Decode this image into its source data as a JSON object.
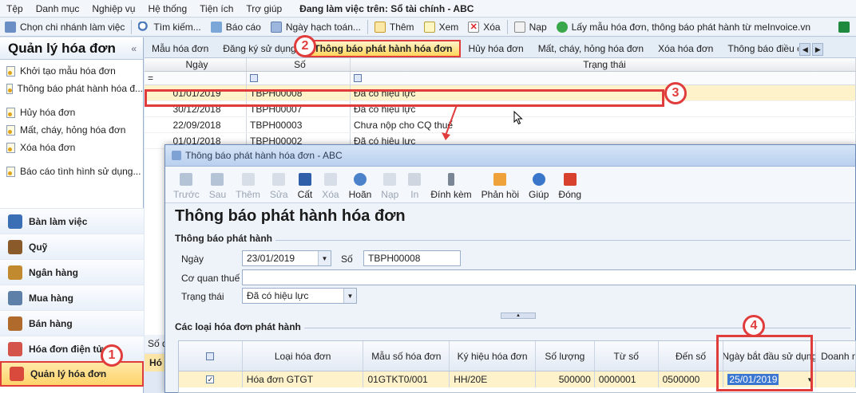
{
  "menu": {
    "items": [
      "Tệp",
      "Danh mục",
      "Nghiệp vụ",
      "Hệ thống",
      "Tiện ích",
      "Trợ giúp"
    ],
    "working_on": "Đang làm việc trên: Sổ tài chính - ABC"
  },
  "toolbar": {
    "branch": "Chọn chi nhánh làm việc",
    "search": "Tìm kiếm...",
    "report": "Báo cáo",
    "posting_date": "Ngày hạch toán...",
    "add": "Thêm",
    "view": "Xem",
    "delete": "Xóa",
    "load": "Nạp",
    "get_template": "Lấy mẫu hóa đơn, thông báo phát hành từ meInvoice.vn"
  },
  "sidebar": {
    "title": "Quản lý hóa đơn",
    "collapse": "«",
    "items": [
      "Khởi tạo mẫu hóa đơn",
      "Thông báo phát hành hóa đ...",
      "Hủy hóa đơn",
      "Mất, cháy, hỏng hóa đơn",
      "Xóa hóa đơn",
      "Báo cáo tình hình sử dụng..."
    ],
    "modules": [
      "Bàn làm việc",
      "Quỹ",
      "Ngân hàng",
      "Mua hàng",
      "Bán hàng",
      "Hóa đơn điện tử",
      "Quản lý hóa đơn"
    ]
  },
  "tabs": [
    "Mẫu hóa đơn",
    "Đăng ký sử dụng h",
    "Thông báo phát hành hóa đơn",
    "Hủy hóa đơn",
    "Mất, cháy, hỏng hóa đơn",
    "Xóa hóa đơn",
    "Thông báo điều ch"
  ],
  "grid": {
    "headers": [
      "Ngày",
      "Số",
      "Trạng thái"
    ],
    "filter_eq": "=",
    "rows": [
      {
        "date": "01/01/2019",
        "no": "TBPH00008",
        "status": "Đã có hiệu lực"
      },
      {
        "date": "30/12/2018",
        "no": "TBPH00007",
        "status": "Đã có hiệu lực"
      },
      {
        "date": "22/09/2018",
        "no": "TBPH00003",
        "status": "Chưa nộp cho CQ thuế"
      },
      {
        "date": "01/01/2018",
        "no": "TBPH00002",
        "status": "Đã có hiệu lực"
      }
    ],
    "status_left": "Số d",
    "bottom_left": "Hó"
  },
  "dialog": {
    "title": "Thông báo phát hành hóa đơn - ABC",
    "buttons": {
      "prev": "Trước",
      "next": "Sau",
      "add": "Thêm",
      "edit": "Sửa",
      "save": "Cất",
      "delete": "Xóa",
      "undo": "Hoãn",
      "load": "Nạp",
      "print": "In",
      "attach": "Đính kèm",
      "feedback": "Phản hồi",
      "help": "Giúp",
      "close": "Đóng"
    },
    "heading": "Thông báo phát hành hóa đơn",
    "section1": "Thông báo phát hành",
    "date_label": "Ngày",
    "date_value": "23/01/2019",
    "no_label": "Số",
    "no_value": "TBPH00008",
    "tax_label": "Cơ quan thuế",
    "tax_value": "",
    "status_label": "Trạng thái",
    "status_value": "Đã có hiệu lực",
    "section2": "Các loại hóa đơn phát hành",
    "cols": [
      "Loại hóa đơn",
      "Mẫu số hóa đơn",
      "Ký hiệu hóa đơn",
      "Số lượng",
      "Từ số",
      "Đến số",
      "Ngày bắt đầu sử dụng",
      "Doanh n"
    ],
    "row": {
      "type": "Hóa đơn GTGT",
      "template": "01GTKT0/001",
      "symbol": "HH/20E",
      "qty": "500000",
      "from": "0000001",
      "to": "0500000",
      "start": "25/01/2019"
    }
  },
  "badges": [
    "1",
    "2",
    "3",
    "4"
  ],
  "colors": {
    "accent": "#e03c3c",
    "selected_row": "#fdf2c9",
    "tab_active": "#ffd55c"
  }
}
